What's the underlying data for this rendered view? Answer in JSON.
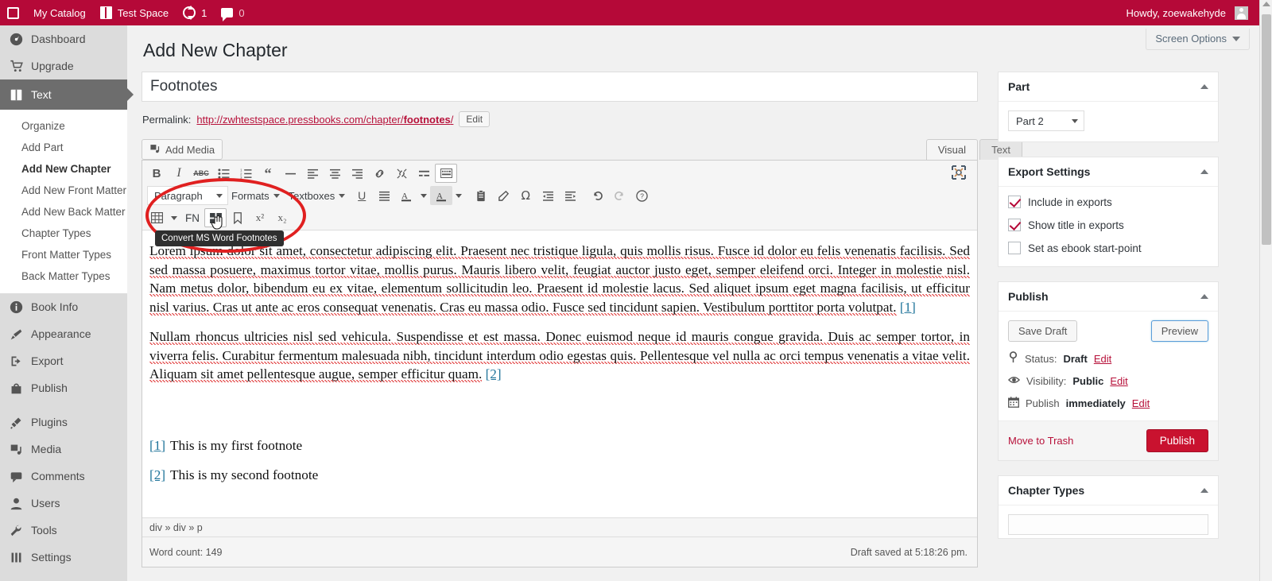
{
  "adminbar": {
    "wp_logo": "wordpress-logo-icon",
    "my_catalog": "My Catalog",
    "site_name": "Test Space",
    "updates_count": "1",
    "comments_count": "0",
    "howdy": "Howdy, zoewakehyde",
    "bg_color": "#b50938"
  },
  "sidebar": {
    "top_items": [
      {
        "label": "Dashboard",
        "icon": "dashboard-icon"
      },
      {
        "label": "Upgrade",
        "icon": "cart-icon"
      }
    ],
    "active_item": {
      "label": "Text",
      "icon": "book-icon"
    },
    "submenu": [
      {
        "label": "Organize",
        "current": false
      },
      {
        "label": "Add Part",
        "current": false
      },
      {
        "label": "Add New Chapter",
        "current": true
      },
      {
        "label": "Add New Front Matter",
        "current": false
      },
      {
        "label": "Add New Back Matter",
        "current": false
      },
      {
        "label": "Chapter Types",
        "current": false
      },
      {
        "label": "Front Matter Types",
        "current": false
      },
      {
        "label": "Back Matter Types",
        "current": false
      }
    ],
    "group_two": [
      {
        "label": "Book Info",
        "icon": "info-icon"
      },
      {
        "label": "Appearance",
        "icon": "brush-icon"
      },
      {
        "label": "Export",
        "icon": "export-icon"
      },
      {
        "label": "Publish",
        "icon": "store-icon"
      }
    ],
    "group_three": [
      {
        "label": "Plugins",
        "icon": "plug-icon"
      },
      {
        "label": "Media",
        "icon": "media-icon"
      },
      {
        "label": "Comments",
        "icon": "comment-icon"
      },
      {
        "label": "Users",
        "icon": "user-icon"
      },
      {
        "label": "Tools",
        "icon": "wrench-icon"
      },
      {
        "label": "Settings",
        "icon": "settings-icon"
      }
    ]
  },
  "screen_options": {
    "label": "Screen Options"
  },
  "page": {
    "title": "Add New Chapter",
    "post_title_value": "Footnotes",
    "permalink_label": "Permalink:",
    "permalink_prefix": "http://zwhtestspace.pressbooks.com/chapter/",
    "permalink_slug": "footnotes",
    "permalink_suffix": "/",
    "permalink_edit": "Edit",
    "add_media": "Add Media"
  },
  "editor": {
    "tab_visual": "Visual",
    "tab_text": "Text",
    "toolbar_row1": [
      {
        "name": "bold-icon",
        "label": "B"
      },
      {
        "name": "italic-icon",
        "label": "I"
      },
      {
        "name": "strikethrough-icon",
        "label": "ABC"
      },
      {
        "name": "bulleted-list-icon",
        "label": ""
      },
      {
        "name": "numbered-list-icon",
        "label": ""
      },
      {
        "name": "blockquote-icon",
        "label": "“"
      },
      {
        "name": "horizontal-rule-icon",
        "label": ""
      },
      {
        "name": "align-left-icon",
        "label": ""
      },
      {
        "name": "align-center-icon",
        "label": ""
      },
      {
        "name": "align-right-icon",
        "label": ""
      },
      {
        "name": "link-icon",
        "label": ""
      },
      {
        "name": "unlink-icon",
        "label": ""
      },
      {
        "name": "read-more-icon",
        "label": ""
      },
      {
        "name": "toolbar-toggle-icon",
        "label": ""
      }
    ],
    "paragraph_select": "Paragraph",
    "formats_menu": "Formats",
    "textboxes_menu": "Textboxes",
    "toolbar_row2": [
      {
        "name": "underline-icon"
      },
      {
        "name": "justify-icon"
      },
      {
        "name": "text-color-icon"
      },
      {
        "name": "highlight-color-icon"
      },
      {
        "name": "paste-as-text-icon"
      },
      {
        "name": "clear-formatting-icon"
      },
      {
        "name": "special-character-icon"
      },
      {
        "name": "outdent-icon"
      },
      {
        "name": "indent-icon"
      },
      {
        "name": "undo-icon"
      },
      {
        "name": "redo-icon"
      },
      {
        "name": "keyboard-shortcuts-icon"
      }
    ],
    "toolbar_row3": [
      {
        "name": "table-icon",
        "label": ""
      },
      {
        "name": "footnote-icon",
        "label": "FN"
      },
      {
        "name": "convert-ms-word-footnotes-icon",
        "label": ""
      },
      {
        "name": "bookmark-icon",
        "label": ""
      },
      {
        "name": "superscript-icon",
        "label": "x²"
      },
      {
        "name": "subscript-icon",
        "label": "x₂"
      }
    ],
    "tooltip": "Convert MS Word Footnotes",
    "fullscreen_icon": "fullscreen-icon",
    "annotation_color": "#e02020",
    "body_paragraph_1": "Lorem ipsum dolor sit amet, consectetur adipiscing elit. Praesent nec tristique ligula, quis mollis risus. Fusce id dolor eu felis venenatis facilisis. Sed sed massa posuere, maximus tortor vitae, mollis purus. Mauris libero velit, feugiat auctor justo eget, semper eleifend orci. Integer in molestie nisl. Nam metus dolor, bibendum eu ex vitae, elementum sollicitudin leo. Praesent id molestie lacus. Sed aliquet ipsum eget magna facilisis, ut efficitur nisl varius. Cras ut ante ac eros consequat venenatis. Cras eu massa odio. Fusce sed tincidunt sapien. Vestibulum porttitor porta volutpat.",
    "body_ref_1": "[1]",
    "body_paragraph_2": "Nullam rhoncus ultricies nisl sed vehicula. Suspendisse et est massa. Donec euismod neque id mauris congue gravida. Duis ac semper tortor, in viverra felis. Curabitur fermentum malesuada nibh, tincidunt interdum odio egestas quis. Pellentesque vel nulla ac orci tempus venenatis a vitae velit. Aliquam sit amet pellentesque augue, semper efficitur quam.",
    "body_ref_2": "[2]",
    "footnote_1_marker": "[1]",
    "footnote_1_text": "This is my first footnote",
    "footnote_2_marker": "[2]",
    "footnote_2_text": "This is my second footnote",
    "path": "div » div » p",
    "word_count": "Word count: 149",
    "saved_status": "Draft saved at 5:18:26 pm."
  },
  "part_panel": {
    "title": "Part",
    "selected": "Part 2"
  },
  "export_panel": {
    "title": "Export Settings",
    "options": [
      {
        "label": "Include in exports",
        "checked": true
      },
      {
        "label": "Show title in exports",
        "checked": true
      },
      {
        "label": "Set as ebook start-point",
        "checked": false
      }
    ],
    "check_color": "#b50938"
  },
  "publish_panel": {
    "title": "Publish",
    "save_draft": "Save Draft",
    "preview": "Preview",
    "status_label": "Status:",
    "status_value": "Draft",
    "status_edit": "Edit",
    "visibility_label": "Visibility:",
    "visibility_value": "Public",
    "visibility_edit": "Edit",
    "schedule_label": "Publish",
    "schedule_value": "immediately",
    "schedule_edit": "Edit",
    "move_to_trash": "Move to Trash",
    "publish_button": "Publish",
    "publish_color": "#c9122f"
  },
  "chapter_types_panel": {
    "title": "Chapter Types"
  }
}
